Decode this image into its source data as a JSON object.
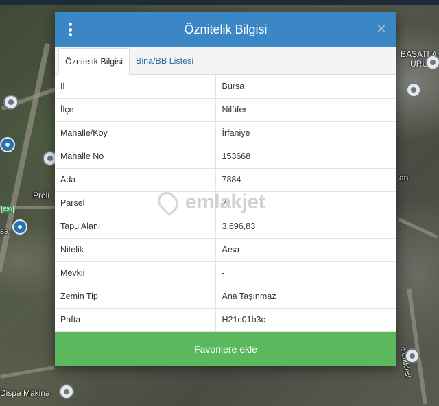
{
  "map": {
    "labels": {
      "top_right_1": "BAŞATLA",
      "top_right_2": "URUN",
      "left_mid": "Proli",
      "left_low": "sa",
      "right_mid": "an",
      "bottom_left": "Dispa Makina",
      "right_vertical": "a Caddesi"
    },
    "highway_shield": "E90"
  },
  "dialog": {
    "title": "Öznitelik Bilgisi",
    "menu_icon": "vertical-dots-icon",
    "close_icon": "close-icon",
    "close_glyph": "×",
    "tabs": [
      {
        "label": "Öznitelik Bilgisi",
        "active": true
      },
      {
        "label": "Bina/BB Listesi",
        "active": false
      }
    ],
    "rows": [
      {
        "key": "İl",
        "value": "Bursa"
      },
      {
        "key": "İlçe",
        "value": "Nilüfer"
      },
      {
        "key": "Mahalle/Köy",
        "value": "İrfaniye"
      },
      {
        "key": "Mahalle No",
        "value": "153668"
      },
      {
        "key": "Ada",
        "value": "7884"
      },
      {
        "key": "Parsel",
        "value": "7"
      },
      {
        "key": "Tapu Alanı",
        "value": "3.696,83"
      },
      {
        "key": "Nitelik",
        "value": "Arsa"
      },
      {
        "key": "Mevkii",
        "value": "-"
      },
      {
        "key": "Zemin Tip",
        "value": "Ana Taşınmaz"
      },
      {
        "key": "Pafta",
        "value": "H21c01b3c"
      }
    ],
    "favorite_button": "Favorilere ekle"
  },
  "watermark": "emlakjet",
  "colors": {
    "header": "#3b87c6",
    "favorite_button": "#5cb85c",
    "tab_link": "#3a6f9b"
  }
}
